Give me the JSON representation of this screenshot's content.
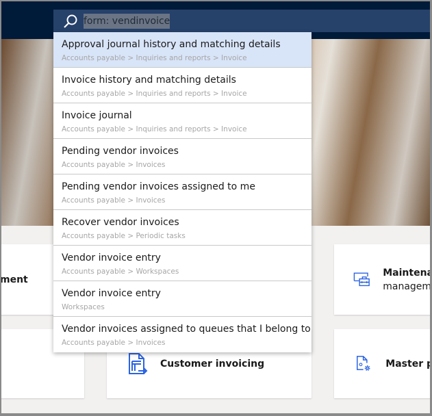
{
  "search": {
    "value": "form: vendinvoice",
    "icon": "search-icon"
  },
  "results": [
    {
      "title": "Approval journal history and matching details",
      "path": "Accounts payable > Inquiries and reports > Invoice"
    },
    {
      "title": "Invoice history and matching details",
      "path": "Accounts payable > Inquiries and reports > Invoice"
    },
    {
      "title": "Invoice journal",
      "path": "Accounts payable > Inquiries and reports > Invoice"
    },
    {
      "title": "Pending vendor invoices",
      "path": "Accounts payable > Invoices"
    },
    {
      "title": "Pending vendor invoices assigned to me",
      "path": "Accounts payable > Invoices"
    },
    {
      "title": "Recover vendor invoices",
      "path": "Accounts payable > Periodic tasks"
    },
    {
      "title": "Vendor invoice entry",
      "path": "Accounts payable > Workspaces"
    },
    {
      "title": "Vendor invoice entry",
      "path": "Workspaces"
    },
    {
      "title": "Vendor invoices assigned to queues that I belong to",
      "path": "Accounts payable > Invoices"
    }
  ],
  "tiles": {
    "left_top": "ment",
    "right_top_line1": "Maintena",
    "right_top_line2": "managem",
    "customer_invoicing": "Customer invoicing",
    "master": "Master p"
  },
  "colors": {
    "accent": "#2b63e0",
    "nav": "#001a3a",
    "search": "#26416a"
  }
}
